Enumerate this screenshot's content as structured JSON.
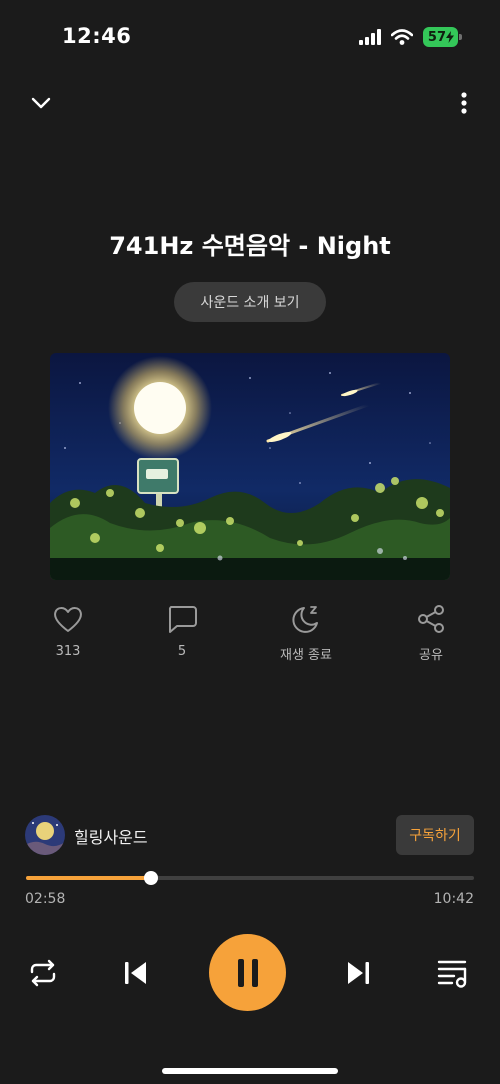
{
  "status_bar": {
    "time": "12:46",
    "battery": "57",
    "icons": [
      "cellular-signal-icon",
      "wifi-icon",
      "battery-charging-icon"
    ]
  },
  "top_bar": {
    "icons": [
      "chevron-down-icon",
      "more-vertical-icon"
    ]
  },
  "track": {
    "title": "741Hz 수면음악 - Night",
    "intro_button": "사운드 소개 보기",
    "artwork": "night-sky-streetlamp-image"
  },
  "actions": {
    "like": {
      "count": "313",
      "icon": "heart-icon"
    },
    "comment": {
      "count": "5",
      "icon": "comment-icon"
    },
    "sleep_timer": {
      "label": "재생 종료",
      "icon": "moon-sleep-icon"
    },
    "share": {
      "label": "공유",
      "icon": "share-icon"
    }
  },
  "channel": {
    "name": "힐링사운드",
    "subscribe_label": "구독하기"
  },
  "playback": {
    "current_time": "02:58",
    "total_time": "10:42",
    "progress_fraction": 0.278
  },
  "controls": {
    "icons": [
      "repeat-icon",
      "previous-track-icon",
      "pause-icon",
      "next-track-icon",
      "playlist-icon"
    ]
  },
  "colors": {
    "accent": "#f6a23a",
    "background": "#1b1b1b",
    "button_bg": "#3a3a3a",
    "battery": "#34c759"
  }
}
